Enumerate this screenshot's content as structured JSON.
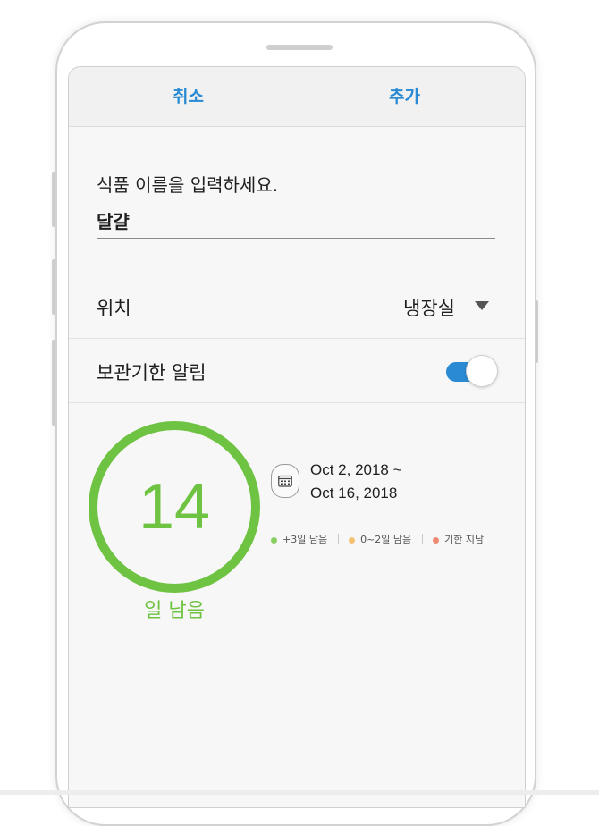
{
  "header": {
    "cancel_label": "취소",
    "add_label": "추가"
  },
  "food": {
    "name_placeholder": "식품 이름을 입력하세요.",
    "name_value": "달걀"
  },
  "location": {
    "label": "위치",
    "value": "냉장실"
  },
  "expiry_alarm": {
    "label": "보관기한 알림",
    "enabled": true
  },
  "remaining": {
    "days": "14",
    "label": "일 남음",
    "progress_fraction": 1.0
  },
  "date_range": {
    "start": "Oct 2, 2018 ~",
    "end": "Oct 16, 2018"
  },
  "legend": [
    {
      "label": "+3일 남음",
      "color": "#8acf63"
    },
    {
      "label": "0~2일 남음",
      "color": "#f4c171"
    },
    {
      "label": "기한 지남",
      "color": "#ee8a74"
    }
  ],
  "colors": {
    "accent": "#2a8ad4",
    "remaining_green": "#6fc342"
  }
}
